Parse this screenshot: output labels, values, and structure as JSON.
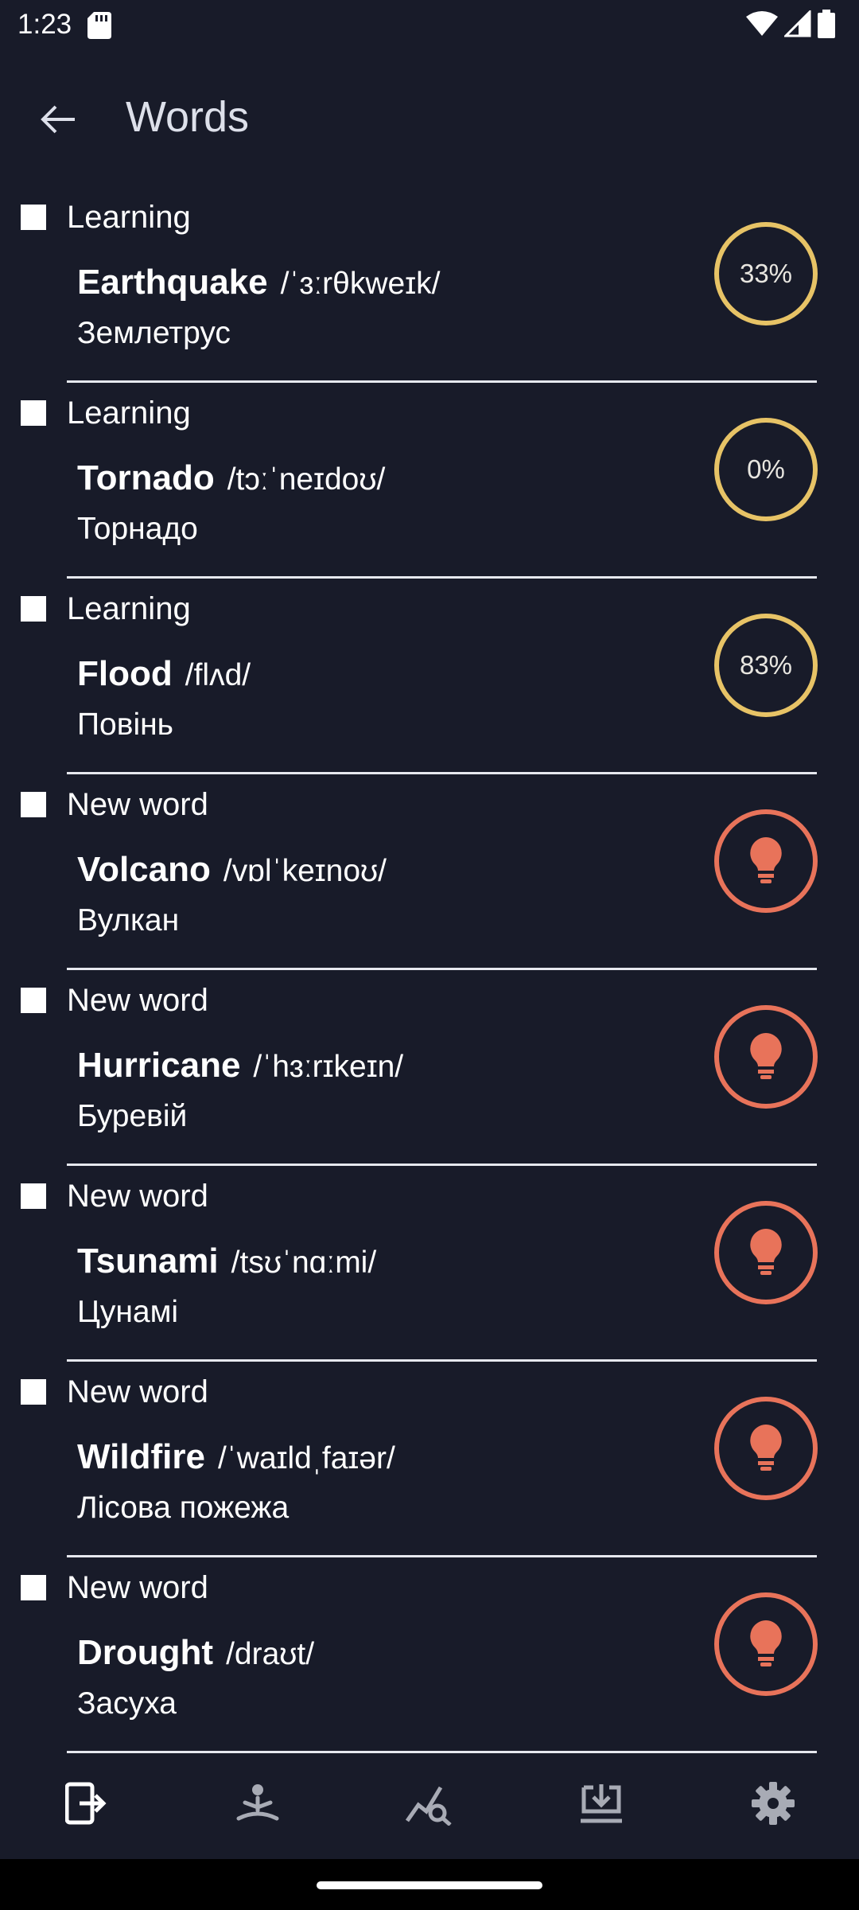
{
  "status_bar": {
    "time": "1:23",
    "icons": [
      "sd-card-icon",
      "wifi-icon",
      "signal-icon",
      "battery-icon"
    ]
  },
  "app_bar": {
    "title": "Words",
    "back_icon": "arrow-back-icon"
  },
  "words": [
    {
      "status": "Learning",
      "word": "Earthquake",
      "transcription": "/ˈɜːrθkweɪk/",
      "translation": "Землетрус",
      "indicator": "progress",
      "progress": "33%"
    },
    {
      "status": "Learning",
      "word": "Tornado",
      "transcription": "/tɔːˈneɪdoʊ/",
      "translation": "Торнадо",
      "indicator": "progress",
      "progress": "0%"
    },
    {
      "status": "Learning",
      "word": "Flood",
      "transcription": "/flʌd/",
      "translation": "Повінь",
      "indicator": "progress",
      "progress": "83%"
    },
    {
      "status": "New word",
      "word": "Volcano",
      "transcription": "/vɒlˈkeɪnoʊ/",
      "translation": "Вулкан",
      "indicator": "bulb-icon"
    },
    {
      "status": "New word",
      "word": "Hurricane",
      "transcription": "/ˈhɜːrɪkeɪn/",
      "translation": "Буревій",
      "indicator": "bulb-icon"
    },
    {
      "status": "New word",
      "word": "Tsunami",
      "transcription": "/tsʊˈnɑːmi/",
      "translation": "Цунамі",
      "indicator": "bulb-icon"
    },
    {
      "status": "New word",
      "word": "Wildfire",
      "transcription": "/ˈwaɪldˌfaɪər/",
      "translation": "Лісова пожежа",
      "indicator": "bulb-icon"
    },
    {
      "status": "New word",
      "word": "Drought",
      "transcription": "/draʊt/",
      "translation": "Засуха",
      "indicator": "bulb-icon"
    }
  ],
  "bottom_nav": {
    "items": [
      "exit-to-app-icon",
      "meditation-icon",
      "stats-search-icon",
      "download-icon",
      "settings-icon"
    ]
  },
  "colors": {
    "background": "#181b29",
    "progress_ring": "#e7c366",
    "bulb": "#e8735a"
  }
}
